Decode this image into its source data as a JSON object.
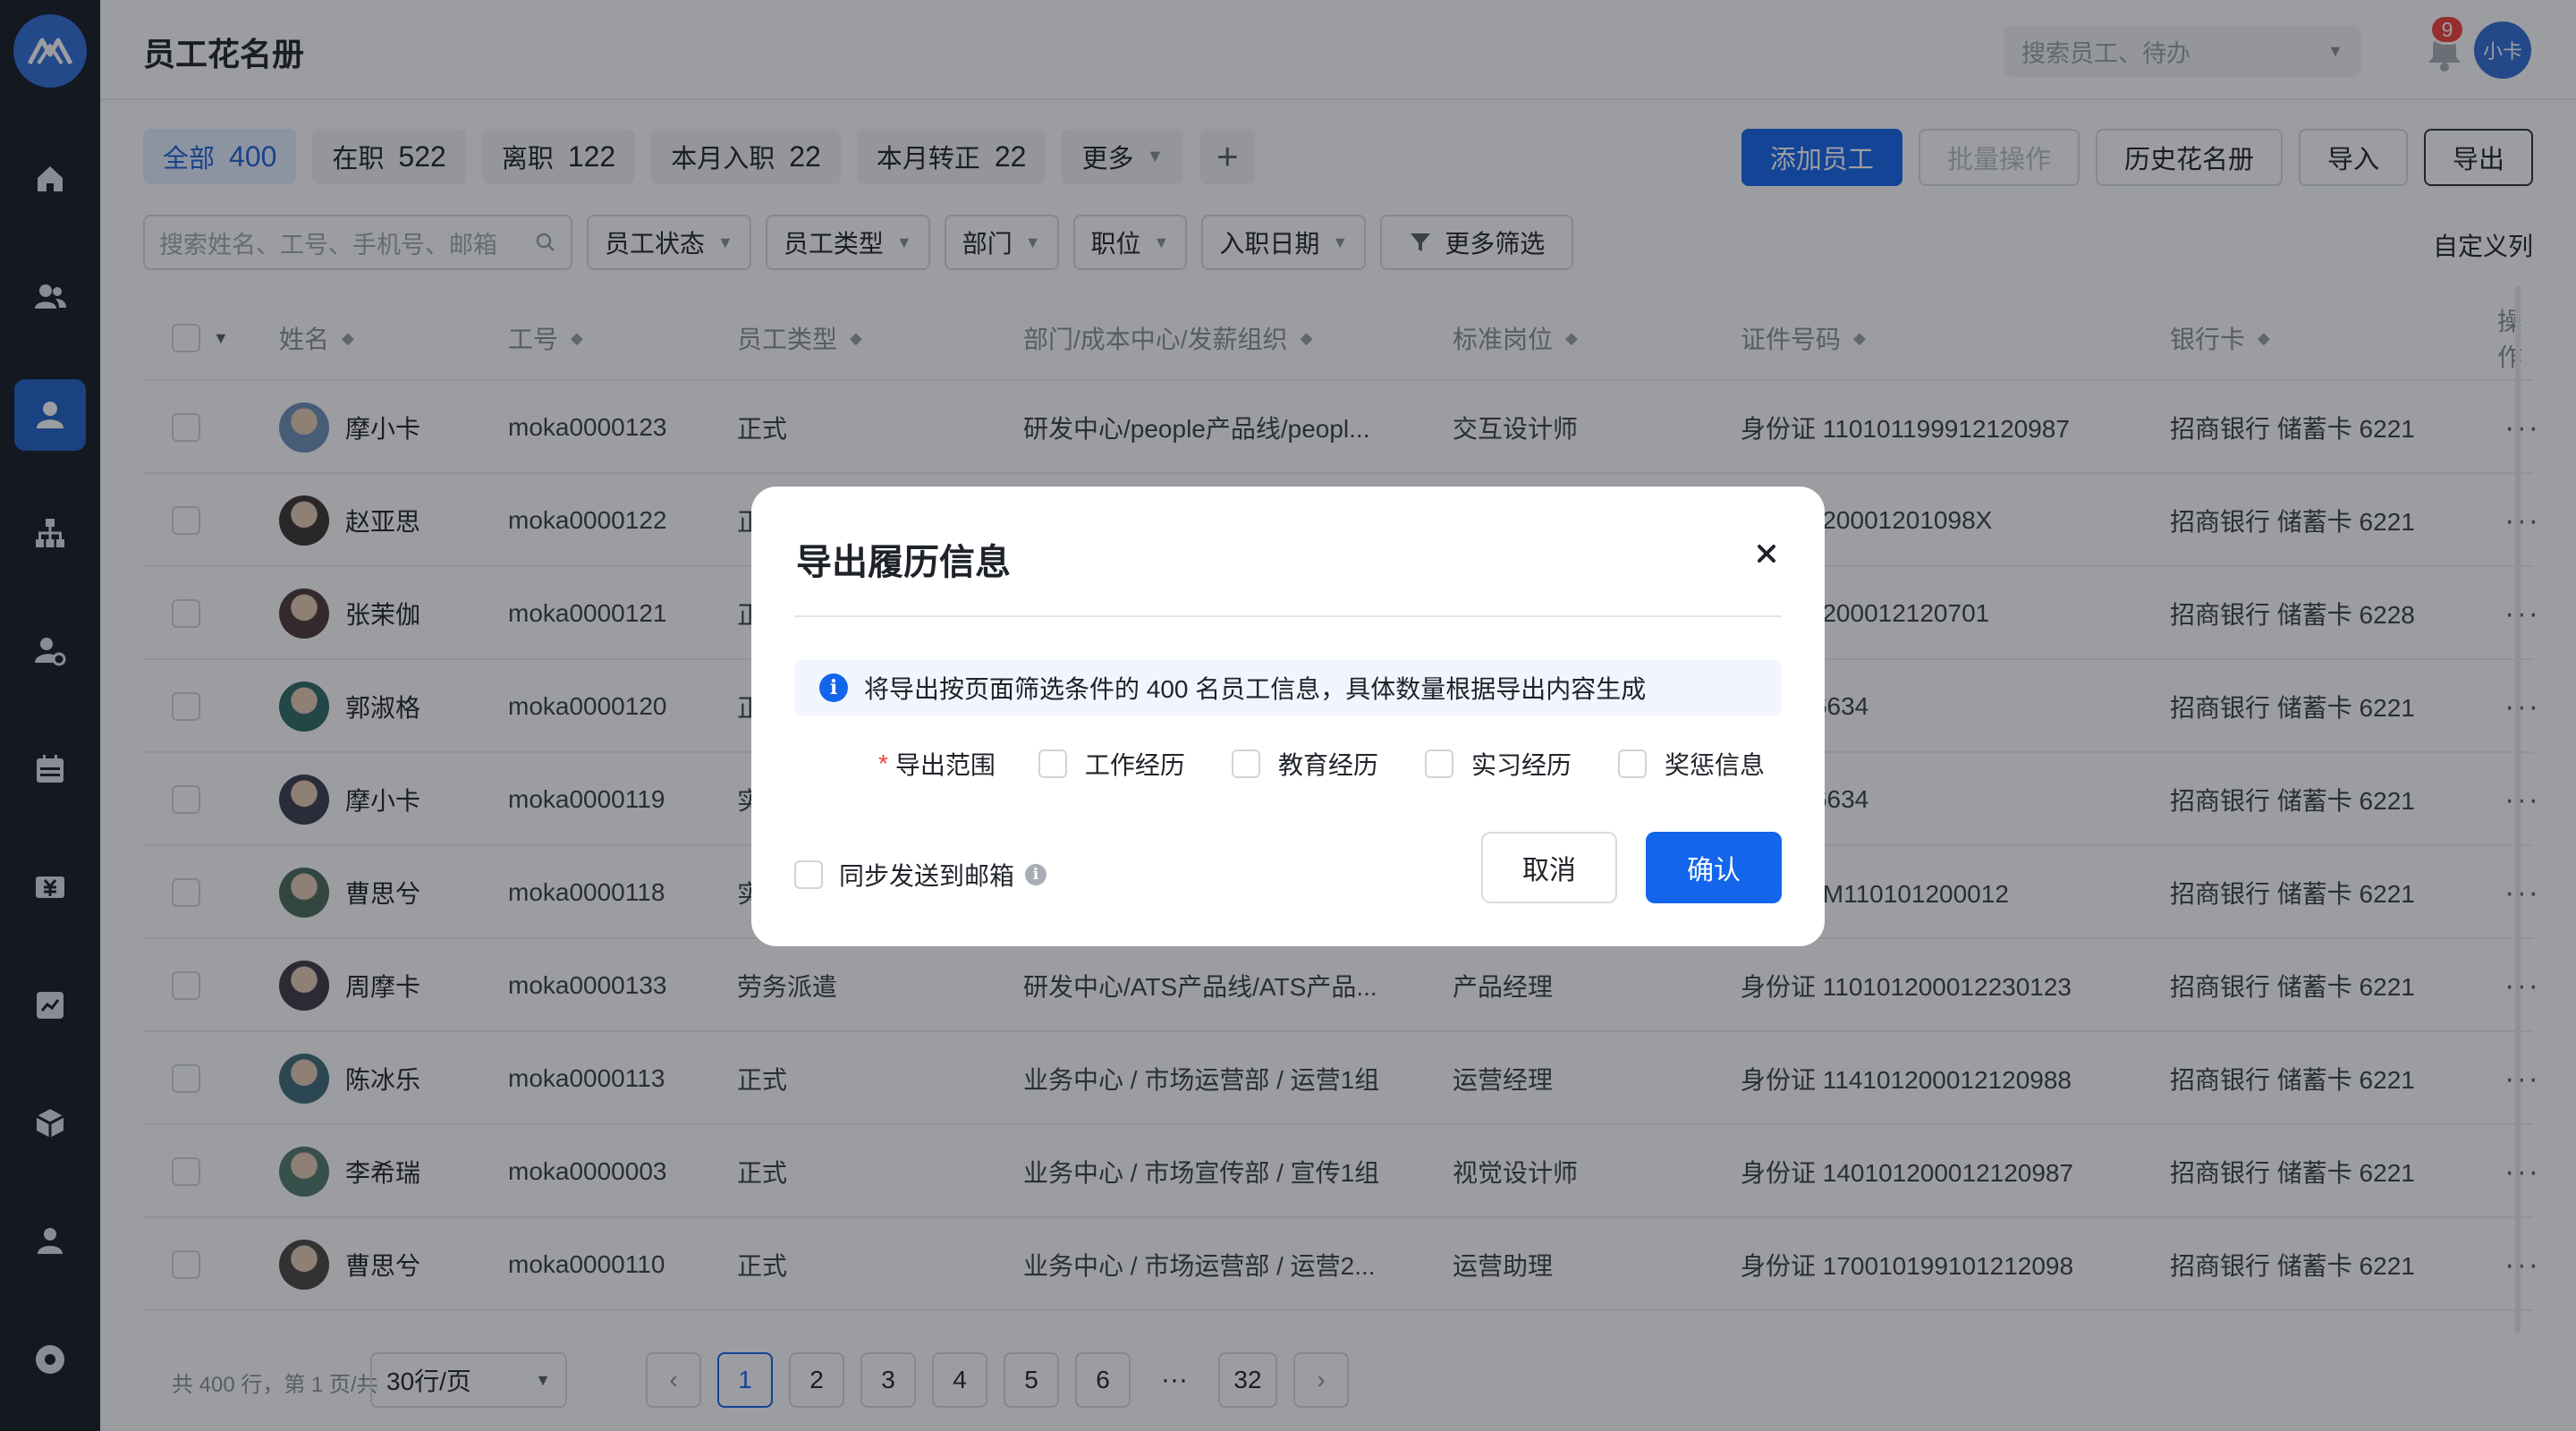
{
  "header": {
    "title": "员工花名册",
    "search_placeholder": "搜索员工、待办",
    "notification_count": "9",
    "user_avatar": "小卡"
  },
  "tabs": [
    {
      "label": "全部",
      "count": "400"
    },
    {
      "label": "在职",
      "count": "522"
    },
    {
      "label": "离职",
      "count": "122"
    },
    {
      "label": "本月入职",
      "count": "22"
    },
    {
      "label": "本月转正",
      "count": "22"
    },
    {
      "label": "更多",
      "count": ""
    }
  ],
  "actions": {
    "add_employee": "添加员工",
    "batch": "批量操作",
    "history": "历史花名册",
    "import": "导入",
    "export": "导出"
  },
  "filters": {
    "search_placeholder": "搜索姓名、工号、手机号、邮箱",
    "status": "员工状态",
    "type": "员工类型",
    "dept": "部门",
    "position": "职位",
    "hire_date": "入职日期",
    "more": "更多筛选",
    "custom_columns": "自定义列"
  },
  "table": {
    "columns": [
      "姓名",
      "工号",
      "员工类型",
      "部门/成本中心/发薪组织",
      "标准岗位",
      "证件号码",
      "银行卡",
      "操作"
    ],
    "rows": [
      {
        "name": "摩小卡",
        "id": "moka0000123",
        "type": "正式",
        "dept": "研发中心/people产品线/peopl...",
        "post": "交互设计师",
        "cert": "身份证 110101199912120987",
        "bank": "招商银行 储蓄卡 6221"
      },
      {
        "name": "赵亚思",
        "id": "moka0000122",
        "type": "正",
        "dept": "",
        "post": "",
        "cert": "11010120001201098X",
        "bank": "招商银行 储蓄卡 6221"
      },
      {
        "name": "张茉伽",
        "id": "moka0000121",
        "type": "正",
        "dept": "",
        "post": "",
        "cert": "110101200012120701",
        "bank": "招商银行 储蓄卡 6228"
      },
      {
        "name": "郭淑格",
        "id": "moka0000120",
        "type": "正",
        "dept": "",
        "post": "",
        "cert": "E87346634",
        "bank": "招商银行 储蓄卡 6221"
      },
      {
        "name": "摩小卡",
        "id": "moka0000119",
        "type": "实",
        "dept": "",
        "post": "",
        "cert": "E87346634",
        "bank": "招商银行 储蓄卡 6221"
      },
      {
        "name": "曹思兮",
        "id": "moka0000118",
        "type": "实",
        "dept": "",
        "post": "",
        "cert": "通行证 M110101200012",
        "bank": "招商银行 储蓄卡 6221"
      },
      {
        "name": "周摩卡",
        "id": "moka0000133",
        "type": "劳务派遣",
        "dept": "研发中心/ATS产品线/ATS产品...",
        "post": "产品经理",
        "cert": "身份证 110101200012230123",
        "bank": "招商银行 储蓄卡 6221"
      },
      {
        "name": "陈冰乐",
        "id": "moka0000113",
        "type": "正式",
        "dept": "业务中心 / 市场运营部 / 运营1组",
        "post": "运营经理",
        "cert": "身份证 114101200012120988",
        "bank": "招商银行 储蓄卡 6221"
      },
      {
        "name": "李希瑞",
        "id": "moka0000003",
        "type": "正式",
        "dept": "业务中心 / 市场宣传部 / 宣传1组",
        "post": "视觉设计师",
        "cert": "身份证 140101200012120987",
        "bank": "招商银行 储蓄卡 6221"
      },
      {
        "name": "曹思兮",
        "id": "moka0000110",
        "type": "正式",
        "dept": "业务中心 / 市场运营部 / 运营2...",
        "post": "运营助理",
        "cert": "身份证 170010199101212098",
        "bank": "招商银行 储蓄卡 6221"
      }
    ]
  },
  "pagination": {
    "info": "共 400 行，第 1 页/共",
    "page_size": "30行/页",
    "pages": [
      "1",
      "2",
      "3",
      "4",
      "5",
      "6",
      "···",
      "32"
    ]
  },
  "modal": {
    "title": "导出履历信息",
    "notice": "将导出按页面筛选条件的 400 名员工信息，具体数量根据导出内容生成",
    "range_label": "导出范围",
    "options": [
      "工作经历",
      "教育经历",
      "实习经历",
      "奖惩信息"
    ],
    "sync_label": "同步发送到邮箱",
    "cancel": "取消",
    "confirm": "确认"
  },
  "colors": {
    "primary": "#1366ec",
    "rail": "#141a24",
    "rail_active": "#2063c6",
    "badge": "#f5403a"
  }
}
